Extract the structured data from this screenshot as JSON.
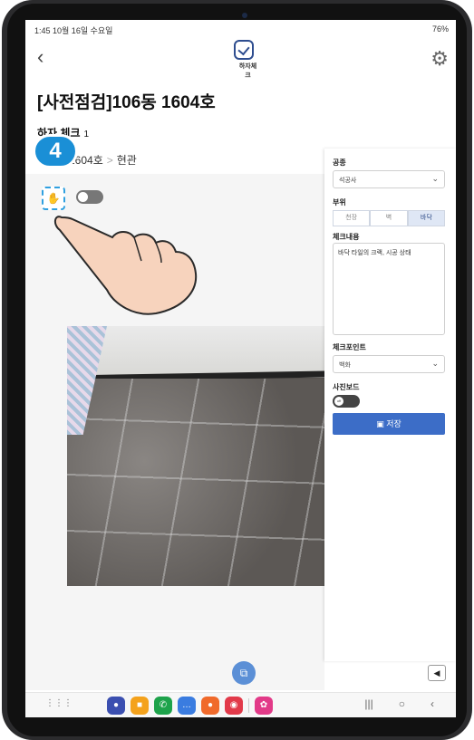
{
  "status": {
    "left": "1:45  10월 16일 수요일",
    "right": "76%"
  },
  "header": {
    "app_label": "하자체크",
    "title": "[사전점검]106동 1604호"
  },
  "section": {
    "title": "하자 체크",
    "count": "1"
  },
  "breadcrumb": {
    "unit": "1604호",
    "location": "현관"
  },
  "step_badge": "4",
  "panel": {
    "trade_label": "공종",
    "trade_value": "석공사",
    "area_label": "부위",
    "area_options": [
      "천장",
      "벽",
      "바닥"
    ],
    "area_selected": "바닥",
    "content_label": "체크내용",
    "content_value": "바닥 타일의 크랙, 시공 상태",
    "point_label": "체크포인트",
    "point_value": "백화",
    "photo_board_label": "사진보드",
    "photo_board_toggle": "off",
    "save_label": "저장"
  },
  "icons": {
    "back": "chevron-left-icon",
    "gear": "gear-icon",
    "pan": "hand-pan-icon",
    "fab": "image-tool-icon"
  },
  "colors": {
    "accent": "#3c6dc7",
    "badge": "#1a8fd6",
    "pan_border": "#2fa0e0"
  }
}
